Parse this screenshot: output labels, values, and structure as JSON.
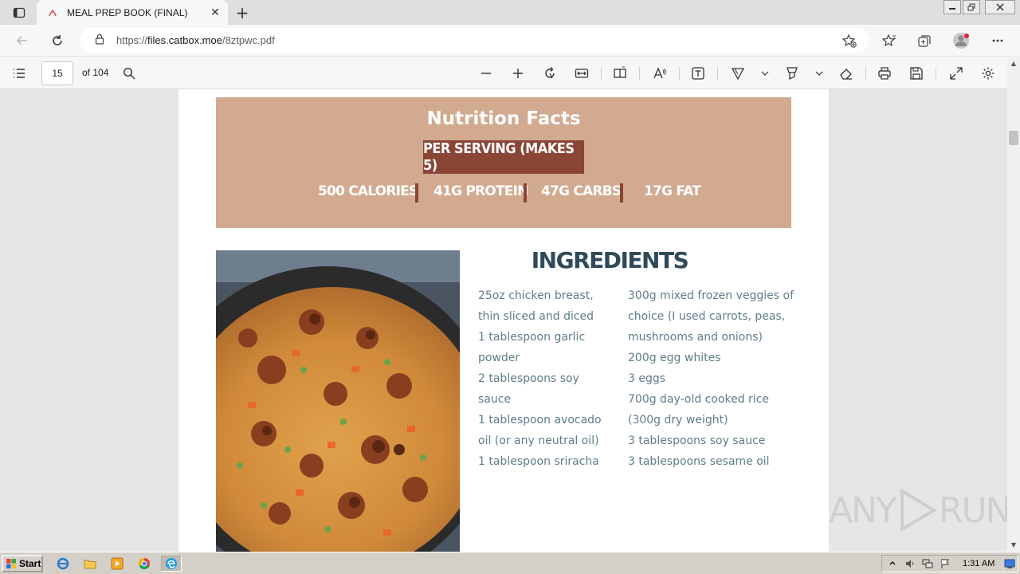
{
  "browser": {
    "tab": {
      "title": "MEAL PREP BOOK (FINAL)"
    },
    "address": {
      "url_prefix": "https://",
      "url_host": "files.catbox.moe",
      "url_path": "/8ztpwc.pdf"
    }
  },
  "pdf_toolbar": {
    "current_page": "15",
    "page_count_label": "of 104"
  },
  "page": {
    "nutrition": {
      "title": "Nutrition Facts",
      "serving": "PER SERVING (MAKES 5)",
      "calories": "500 CALORIES",
      "protein": "41G  PROTEIN",
      "carbs": "47G CARBS",
      "fat": "17G FAT"
    },
    "ingredients": {
      "title": "INGREDIENTS",
      "col1": [
        "25oz chicken breast,",
        "thin sliced and diced",
        "1 tablespoon garlic",
        "powder",
        "2 tablespoons soy",
        "sauce",
        "1 tablespoon avocado",
        "oil (or any neutral oil)",
        "1 tablespoon sriracha"
      ],
      "col2": [
        "300g mixed frozen veggies of",
        "choice (I used carrots, peas,",
        "mushrooms and onions)",
        "200g egg whites",
        "3 eggs",
        "700g day-old cooked rice",
        "(300g dry weight)",
        "3 tablespoons soy sauce",
        "3 tablespoons sesame oil"
      ]
    }
  },
  "watermark": {
    "left": "ANY",
    "right": "RUN"
  },
  "taskbar": {
    "start_label": "Start",
    "clock": "1:31 AM"
  },
  "colors": {
    "nutrition_bg": "#d1aa90",
    "serving_bg": "#8a4535",
    "ingredient_title": "#2f4a5a",
    "ingredient_text": "#5e7d8a"
  }
}
